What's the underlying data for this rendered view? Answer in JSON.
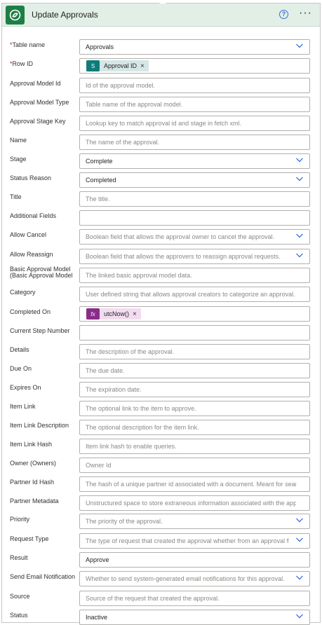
{
  "header": {
    "title": "Update Approvals",
    "app_icon": "dataverse-icon",
    "help_icon": "help-icon",
    "more_icon": "more-icon",
    "more_glyph": "···",
    "help_glyph": "?"
  },
  "fields": {
    "table_name": {
      "required": "*",
      "label": "Table name",
      "value": "Approvals"
    },
    "row_id": {
      "required": "*",
      "label": "Row ID",
      "token": "Approval ID",
      "token_icon": "S",
      "remove": "×"
    },
    "approval_model_id": {
      "label": "Approval Model Id",
      "placeholder": "Id of the approval model."
    },
    "approval_model_type": {
      "label": "Approval Model Type",
      "placeholder": "Table name of the approval model."
    },
    "approval_stage_key": {
      "label": "Approval Stage Key",
      "placeholder": "Lookup key to match approval id and stage in fetch xml."
    },
    "name": {
      "label": "Name",
      "placeholder": "The name of the approval."
    },
    "stage": {
      "label": "Stage",
      "value": "Complete"
    },
    "status_reason": {
      "label": "Status Reason",
      "value": "Completed"
    },
    "title": {
      "label": "Title",
      "placeholder": "The title."
    },
    "additional_fields": {
      "label": "Additional Fields",
      "placeholder": ""
    },
    "allow_cancel": {
      "label": "Allow Cancel",
      "placeholder": "Boolean field that allows the approval owner to cancel the approval."
    },
    "allow_reassign": {
      "label": "Allow Reassign",
      "placeholder": "Boolean field that allows the approvers to reassign approval requests."
    },
    "basic_approval_model": {
      "label": "Basic Approval Model (Basic Approval Model Data)",
      "placeholder": "The linked basic approval model data."
    },
    "category": {
      "label": "Category",
      "placeholder": "User defined string that allows approval creators to categorize an approval."
    },
    "completed_on": {
      "label": "Completed On",
      "token": "utcNow()",
      "token_icon": "fx",
      "remove": "×"
    },
    "current_step_number": {
      "label": "Current Step Number",
      "placeholder": ""
    },
    "details": {
      "label": "Details",
      "placeholder": "The description of the approval."
    },
    "due_on": {
      "label": "Due On",
      "placeholder": "The due date."
    },
    "expires_on": {
      "label": "Expires On",
      "placeholder": "The expiration date."
    },
    "item_link": {
      "label": "Item Link",
      "placeholder": "The optional link to the item to approve."
    },
    "item_link_description": {
      "label": "Item Link Description",
      "placeholder": "The optional description for the item link."
    },
    "item_link_hash": {
      "label": "Item Link Hash",
      "placeholder": "Item link hash to enable queries."
    },
    "owner": {
      "label": "Owner (Owners)",
      "placeholder": "Owner Id"
    },
    "partner_id_hash": {
      "label": "Partner Id Hash",
      "placeholder": "The hash of a unique partner id associated with a document. Meant for search"
    },
    "partner_metadata": {
      "label": "Partner Metadata",
      "placeholder": "Unstructured space to store extraneous information associated with the approval."
    },
    "priority": {
      "label": "Priority",
      "placeholder": "The priority of the approval."
    },
    "request_type": {
      "label": "Request Type",
      "placeholder": "The type of request that created the approval whether from an approval flow."
    },
    "result": {
      "label": "Result",
      "value": "Approve"
    },
    "send_email_notification": {
      "label": "Send Email Notification",
      "placeholder": "Whether to send system-generated email notifications for this approval."
    },
    "source": {
      "label": "Source",
      "placeholder": "Source of the request that created the approval."
    },
    "status": {
      "label": "Status",
      "value": "Inactive"
    }
  },
  "colors": {
    "header_bg": "#e1efe7",
    "app_icon_bg": "#1e7e45",
    "row_id_token_bg": "#d6e6e6",
    "row_id_icon_bg": "#0f7c7c",
    "fx_token_bg": "#f2dcef",
    "fx_icon_bg": "#8a2d8a",
    "dropdown_chevron": "#2b63d9",
    "required": "#a4262c"
  }
}
